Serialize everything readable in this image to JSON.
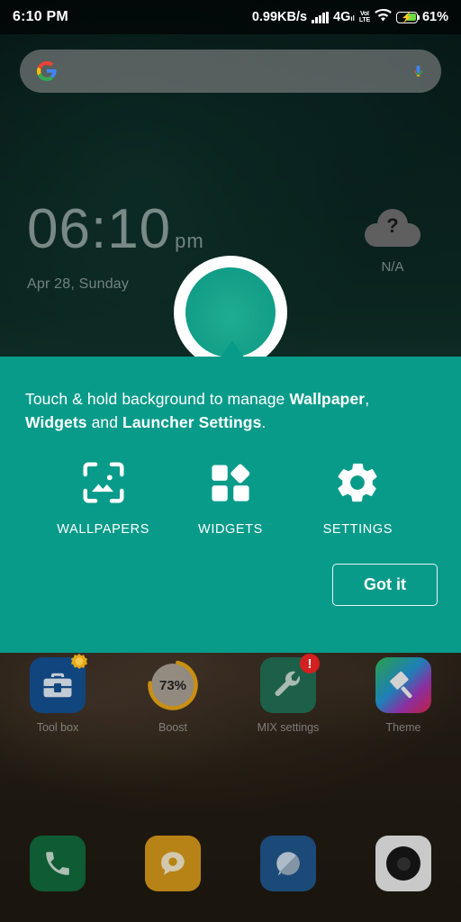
{
  "status_bar": {
    "time": "6:10 PM",
    "network_speed": "0.99KB/s",
    "signal_icon": "signal-bars-icon",
    "network_type": "4G",
    "network_type_sub": "ıl",
    "volte_top": "VoI",
    "volte_bottom": "LTE",
    "wifi_icon": "wifi-icon",
    "battery_icon": "battery-charging-icon",
    "battery_percent": "61%"
  },
  "search": {
    "google_icon": "google-logo-icon",
    "mic_icon": "microphone-icon",
    "placeholder": "",
    "value": ""
  },
  "clock_widget": {
    "time": "06:10",
    "meridiem": "pm",
    "date": "Apr 28, Sunday"
  },
  "weather_widget": {
    "icon": "cloud-question-icon",
    "question_mark": "?",
    "status": "N/A"
  },
  "tutorial": {
    "text_part1": "Touch & hold background to manage ",
    "text_bold1": "Wallpaper",
    "text_part2": ", ",
    "text_bold2": "Widgets",
    "text_part3": " and ",
    "text_bold3": "Launcher Settings",
    "text_part4": ".",
    "accent_color": "#099b8a",
    "actions": [
      {
        "icon": "wallpapers-image-icon",
        "label": "WALLPAPERS"
      },
      {
        "icon": "widgets-grid-icon",
        "label": "WIDGETS"
      },
      {
        "icon": "settings-gear-icon",
        "label": "SETTINGS"
      }
    ],
    "dismiss_label": "Got it"
  },
  "home_apps": [
    {
      "icon": "toolbox-icon",
      "label": "Tool box",
      "badge": "star-badge"
    },
    {
      "icon": "boost-ring-icon",
      "label": "Boost",
      "percent": "73%",
      "ring_color": "#c98f12"
    },
    {
      "icon": "wrench-icon",
      "label": "MIX settings",
      "badge": "!"
    },
    {
      "icon": "paintbrush-icon",
      "label": "Theme"
    }
  ],
  "dock_apps": [
    {
      "icon": "phone-icon",
      "label": "Phone"
    },
    {
      "icon": "messages-icon",
      "label": "Messages"
    },
    {
      "icon": "browser-icon",
      "label": "Browser"
    },
    {
      "icon": "camera-icon",
      "label": "Camera"
    }
  ]
}
